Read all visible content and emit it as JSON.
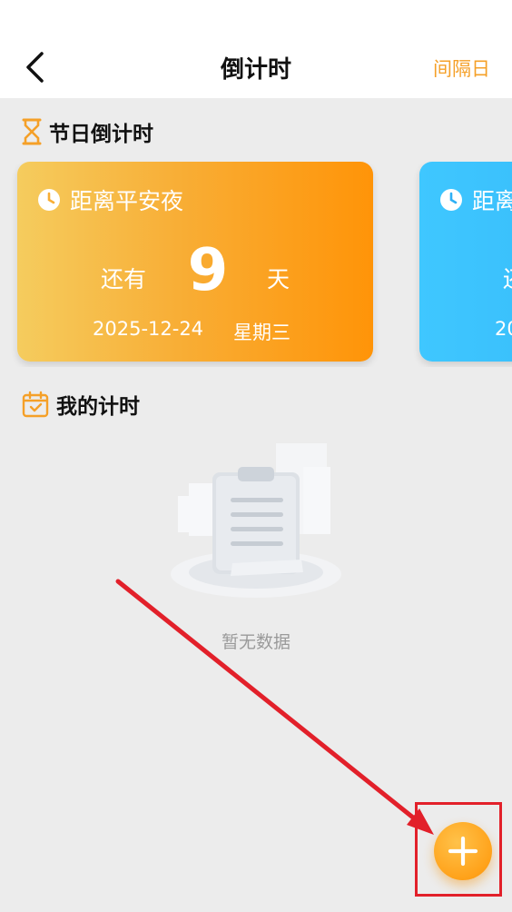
{
  "header": {
    "title": "倒计时",
    "interval_link": "间隔日"
  },
  "festival_section": {
    "label": "节日倒计时",
    "cards": [
      {
        "title": "距离平安夜",
        "remain_prefix": "还有",
        "days": "9",
        "remain_suffix": "天",
        "date": "2025-12-24",
        "weekday": "星期三",
        "color": "#ff9408"
      },
      {
        "title": "距离",
        "remain_prefix": "还",
        "date": "20",
        "color": "#3fc7ff"
      }
    ]
  },
  "my_section": {
    "label": "我的计时",
    "empty_text": "暂无数据"
  },
  "colors": {
    "accent": "#f5a028",
    "annotation": "#e2202a"
  }
}
